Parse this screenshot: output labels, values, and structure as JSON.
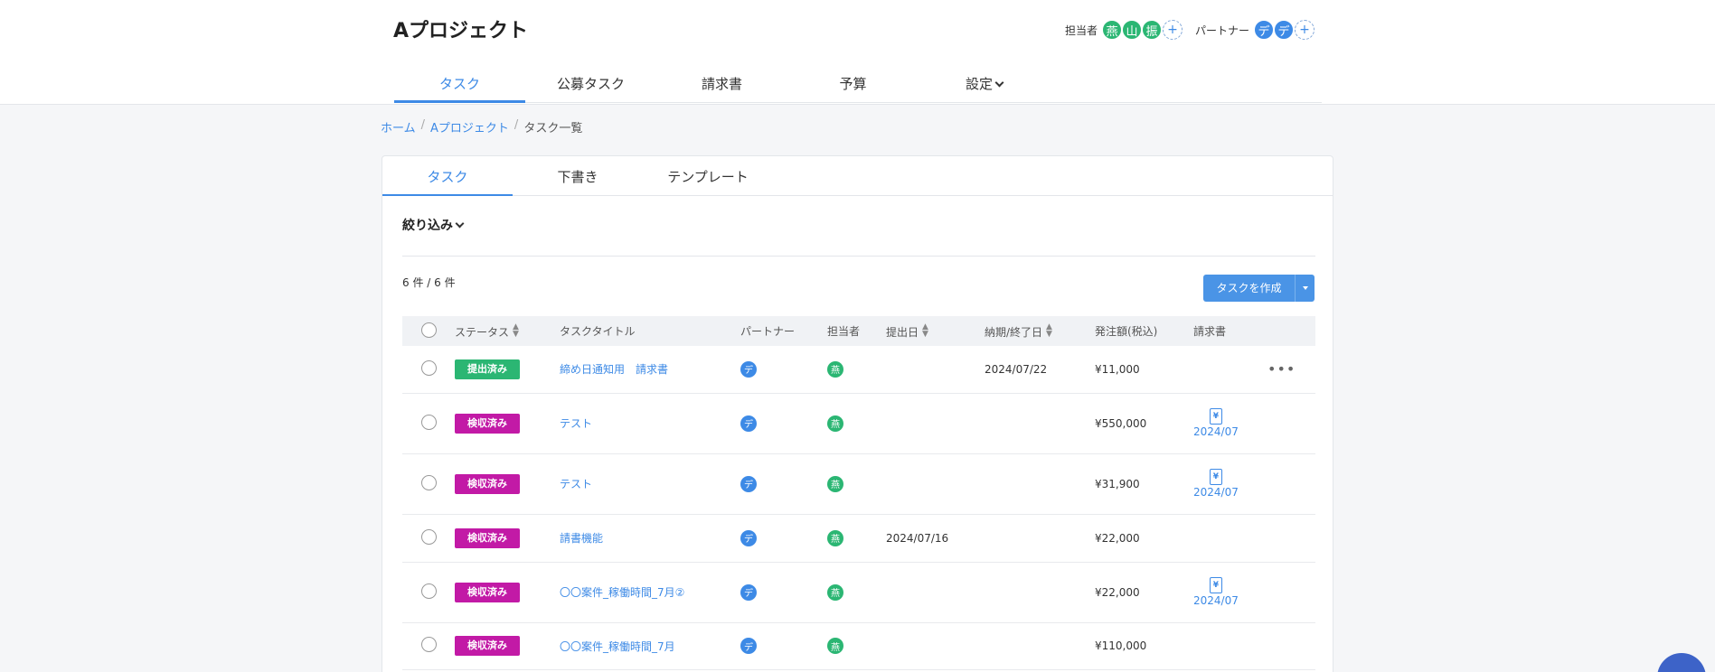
{
  "header": {
    "project_title": "Aプロジェクト",
    "assignee_label": "担当者",
    "assignees": [
      "燕",
      "山",
      "振"
    ],
    "partner_label": "パートナー",
    "partners": [
      "デ",
      "デ"
    ],
    "add_symbol": "+"
  },
  "nav": {
    "tabs": [
      {
        "label": "タスク",
        "active": true
      },
      {
        "label": "公募タスク",
        "active": false
      },
      {
        "label": "請求書",
        "active": false
      },
      {
        "label": "予算",
        "active": false
      },
      {
        "label": "設定",
        "active": false
      }
    ]
  },
  "breadcrumb": [
    "ホーム",
    "Aプロジェクト",
    "タスク一覧"
  ],
  "subtabs": [
    {
      "label": "タスク",
      "active": true
    },
    {
      "label": "下書き",
      "active": false
    },
    {
      "label": "テンプレート",
      "active": false
    }
  ],
  "filter_label": "絞り込み",
  "count_text": "6 件 / 6 件",
  "create_button": "タスクを作成",
  "table": {
    "headers": [
      "ステータス",
      "タスクタイトル",
      "パートナー",
      "担当者",
      "提出日",
      "納期/終了日",
      "発注額(税込)",
      "請求書"
    ],
    "rows": [
      {
        "status": "提出済み",
        "status_color": "green",
        "title": "締め日通知用　請求書",
        "partner": "デ",
        "assignee": "燕",
        "submitted": "",
        "due": "2024/07/22",
        "amount": "¥11,000",
        "invoice": "",
        "menu": "•••"
      },
      {
        "status": "検収済み",
        "status_color": "purple",
        "title": "テスト",
        "partner": "デ",
        "assignee": "燕",
        "submitted": "",
        "due": "",
        "amount": "¥550,000",
        "invoice": "2024/07",
        "menu": ""
      },
      {
        "status": "検収済み",
        "status_color": "purple",
        "title": "テスト",
        "partner": "デ",
        "assignee": "燕",
        "submitted": "",
        "due": "",
        "amount": "¥31,900",
        "invoice": "2024/07",
        "menu": ""
      },
      {
        "status": "検収済み",
        "status_color": "purple",
        "title": "請書機能",
        "partner": "デ",
        "assignee": "燕",
        "submitted": "2024/07/16",
        "due": "",
        "amount": "¥22,000",
        "invoice": "",
        "menu": ""
      },
      {
        "status": "検収済み",
        "status_color": "purple",
        "title": "〇〇案件_稼働時間_7月②",
        "partner": "デ",
        "assignee": "燕",
        "submitted": "",
        "due": "",
        "amount": "¥22,000",
        "invoice": "2024/07",
        "menu": ""
      },
      {
        "status": "検収済み",
        "status_color": "purple",
        "title": "〇〇案件_稼働時間_7月",
        "partner": "デ",
        "assignee": "燕",
        "submitted": "",
        "due": "",
        "amount": "¥110,000",
        "invoice": "",
        "menu": ""
      }
    ]
  },
  "invoice_icon_glyph": "¥",
  "colors": {
    "accent": "#3d8ae6",
    "green": "#2bb673",
    "purple": "#c21aa6"
  }
}
